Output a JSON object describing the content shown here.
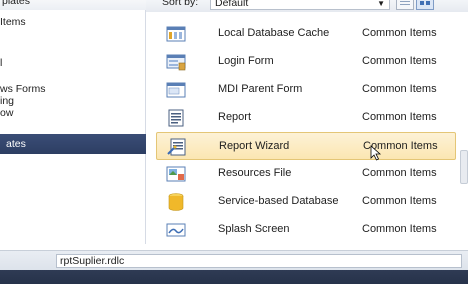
{
  "left_tree": {
    "top_partial": "plates",
    "items": [
      {
        "label": "Items"
      },
      {
        "label": "l"
      },
      {
        "label": "ws Forms"
      },
      {
        "label": "ing"
      },
      {
        "label": "ow"
      }
    ],
    "selected_label": "ates"
  },
  "header": {
    "sort_label": "Sort by:",
    "sort_value": "Default"
  },
  "templates": [
    {
      "name": "Local Database Cache",
      "category": "Common Items",
      "icon": "local-database-cache-icon"
    },
    {
      "name": "Login Form",
      "category": "Common Items",
      "icon": "login-form-icon"
    },
    {
      "name": "MDI Parent Form",
      "category": "Common Items",
      "icon": "mdi-parent-form-icon"
    },
    {
      "name": "Report",
      "category": "Common Items",
      "icon": "report-icon"
    },
    {
      "name": "Report Wizard",
      "category": "Common Items",
      "icon": "report-wizard-icon",
      "selected": true
    },
    {
      "name": "Resources File",
      "category": "Common Items",
      "icon": "resources-file-icon"
    },
    {
      "name": "Service-based Database",
      "category": "Common Items",
      "icon": "service-based-database-icon"
    },
    {
      "name": "Splash Screen",
      "category": "Common Items",
      "icon": "splash-screen-icon"
    }
  ],
  "name_field": {
    "value": "rptSuplier.rdlc"
  },
  "colors": {
    "selection_bg": "#fbe6b2",
    "tree_selected_bg": "#2d3e63"
  }
}
